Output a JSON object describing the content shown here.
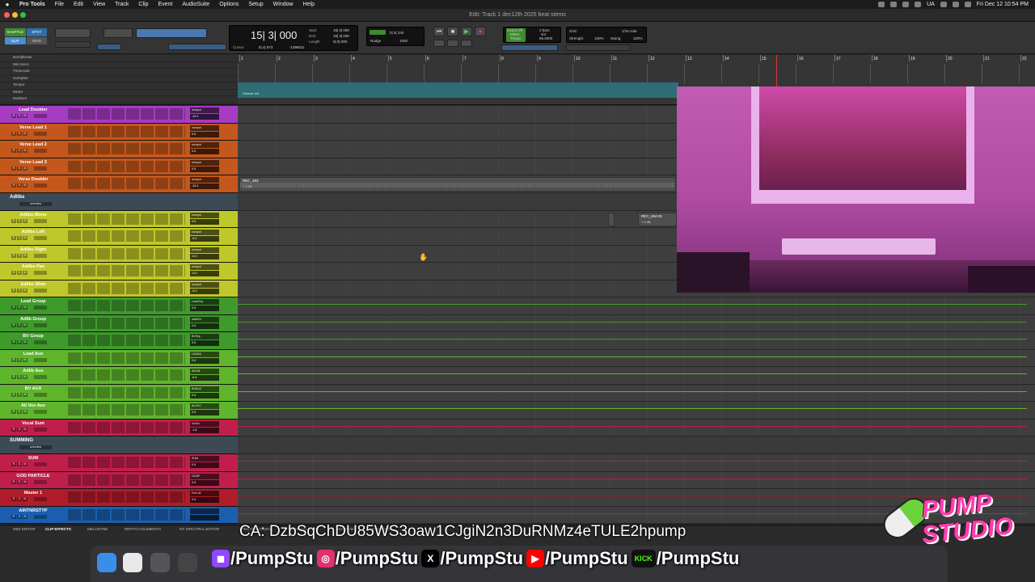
{
  "menubar": {
    "app_name": "Pro Tools",
    "items": [
      "File",
      "Edit",
      "View",
      "Track",
      "Clip",
      "Event",
      "AudioSuite",
      "Options",
      "Setup",
      "Window",
      "Help"
    ],
    "user_initials": "UA",
    "datetime": "Fri Dec 12  10:54 PM"
  },
  "window": {
    "title": "Edit: Track 1 dec12th 2025 beat stems"
  },
  "toolbar": {
    "modes": [
      "SHUFFLE",
      "SPOT",
      "SLIP",
      "GRID"
    ],
    "counter_main": "15| 3| 000",
    "counter_labels": [
      "Start",
      "End",
      "Length"
    ],
    "counter_values": [
      "15| 3| 000",
      "15| 3| 000",
      "0| 0| 000"
    ],
    "cursor_label": "Cursor",
    "cursor_value": "5| 4| 673",
    "cursor_sample": "-1386011",
    "nudge_label": "Nudge",
    "grid_value": "0| 0| 240",
    "nudge_value": "1000",
    "countoff": "Count Off",
    "meter": "Meter",
    "tempo": "Tempo",
    "countoff_value": "2 bars",
    "meter_value": "4/4",
    "tempo_value": "86.0000",
    "grid_label": "Grid:",
    "grid_note": "1/16 note",
    "strength_label": "Strength:",
    "strength_value": "100%",
    "swing_label": "Swing:",
    "swing_value": "100%"
  },
  "rulers": {
    "labels": [
      "Bars|Beats",
      "Min:Secs",
      "Timecode",
      "Samples",
      "Tempo",
      "Meter",
      "Markers"
    ],
    "bars": [
      "1",
      "2",
      "3",
      "4",
      "5",
      "6",
      "7",
      "8",
      "9",
      "10",
      "11",
      "12",
      "13",
      "14",
      "15",
      "16",
      "17",
      "18",
      "19",
      "20",
      "21",
      "22"
    ],
    "meter_text": "Default: 4/4"
  },
  "tracks": [
    {
      "name": "Lead Doubler",
      "color": "#a63cc2",
      "io": "noinput",
      "vol": "-10.1"
    },
    {
      "name": "Verse Lead 1",
      "color": "#c4571c",
      "io": "noinput",
      "vol": "0.0"
    },
    {
      "name": "Verse Lead 2",
      "color": "#c4571c",
      "io": "noinput",
      "vol": "0.0"
    },
    {
      "name": "Verse Lead 3",
      "color": "#c4571c",
      "io": "noinput",
      "vol": "0.0"
    },
    {
      "name": "Verse Doubler",
      "color": "#c4571c",
      "io": "noinput",
      "vol": "-10.1"
    },
    {
      "folder": true,
      "name": "Adlibs",
      "view": "overview"
    },
    {
      "name": "Adlibs Mono",
      "color": "#bfc82a",
      "io": "noinput",
      "vol": "0.0"
    },
    {
      "name": "Adlibs Left",
      "color": "#bfc82a",
      "io": "noinput",
      "vol": "-5.0"
    },
    {
      "name": "Adlibs Right",
      "color": "#bfc82a",
      "io": "noinput",
      "vol": "-5.0"
    },
    {
      "name": "Adlibs Pan",
      "color": "#bfc82a",
      "io": "noinput",
      "vol": "-5.0"
    },
    {
      "name": "Adlibs Wide",
      "color": "#bfc82a",
      "io": "noinput",
      "vol": "-5.0"
    },
    {
      "name": "Lead Group",
      "color": "#3f9a2c",
      "io": "LeadGrp",
      "vol": "0.0"
    },
    {
      "name": "Adlib Group",
      "color": "#3f9a2c",
      "io": "AdlibGr",
      "vol": "0.0"
    },
    {
      "name": "BV Group",
      "color": "#3f9a2c",
      "io": "BVGrp",
      "vol": "0.0"
    },
    {
      "name": "Lead Aux",
      "color": "#5fb52c",
      "io": "LEADA",
      "vol": "0.0"
    },
    {
      "name": "Adlib Aux",
      "color": "#5fb52c",
      "io": "ADLIB",
      "vol": "-6.5"
    },
    {
      "name": "BV AUX",
      "color": "#5fb52c",
      "io": "BVAUX",
      "vol": "0.0"
    },
    {
      "name": "All Vox Aux",
      "color": "#5fb52c",
      "io": "ALVOC",
      "vol": "0.0"
    },
    {
      "name": "Vocal Sum",
      "color": "#c01f4c",
      "io": "VoSm",
      "vol": "-1.6"
    },
    {
      "folder": true,
      "name": "SUMMING",
      "view": "overview"
    },
    {
      "name": "SUM",
      "color": "#c01f4c",
      "io": "SUM",
      "vol": "0.0"
    },
    {
      "name": "GOD PARTICLE",
      "color": "#c01f4c",
      "io": "GODP",
      "vol": "0.0"
    },
    {
      "name": "Master 1",
      "color": "#b01c2a",
      "io": "Frnt.18",
      "vol": "0.0"
    },
    {
      "name": "AINTNRSTYP",
      "color": "#1c5fb0",
      "io": "",
      "vol": ""
    }
  ],
  "clips": {
    "verse_doubler": {
      "name": "REC_483",
      "gain": "+ 0 dB"
    },
    "adlibs_mono": {
      "name": "REC_494-01",
      "gain": "+ 0 dB"
    }
  },
  "bottom_tabs": [
    "MIDI EDITOR",
    "CLIP EFFECTS",
    "MELODYNE",
    "REPITCH ELEMENTS",
    "RX SPECTRAL EDITOR",
    "SPECTRALAYERS",
    "VOCALIGN 6 PRO",
    "WAVELAB",
    "SYNAPSIS"
  ],
  "overlay": {
    "ca_text": "CA: DzbSqChDU85WS3oaw1CJgiN2n3DuRNMz4eTULE2hpump",
    "socials": [
      {
        "icon": "twitch-icon",
        "handle": "/PumpStu",
        "color": "#9146ff"
      },
      {
        "icon": "instagram-icon",
        "handle": "/PumpStu",
        "color": "#e1306c"
      },
      {
        "icon": "x-icon",
        "handle": "/PumpStu",
        "color": "#000000"
      },
      {
        "icon": "youtube-icon",
        "handle": "/PumpStu",
        "color": "#ff0000"
      },
      {
        "icon": "kick-icon",
        "handle": "/PumpStu",
        "color": "#53fc18"
      }
    ],
    "logo_top": "PUMP",
    "logo_bottom": "STUDIO"
  }
}
